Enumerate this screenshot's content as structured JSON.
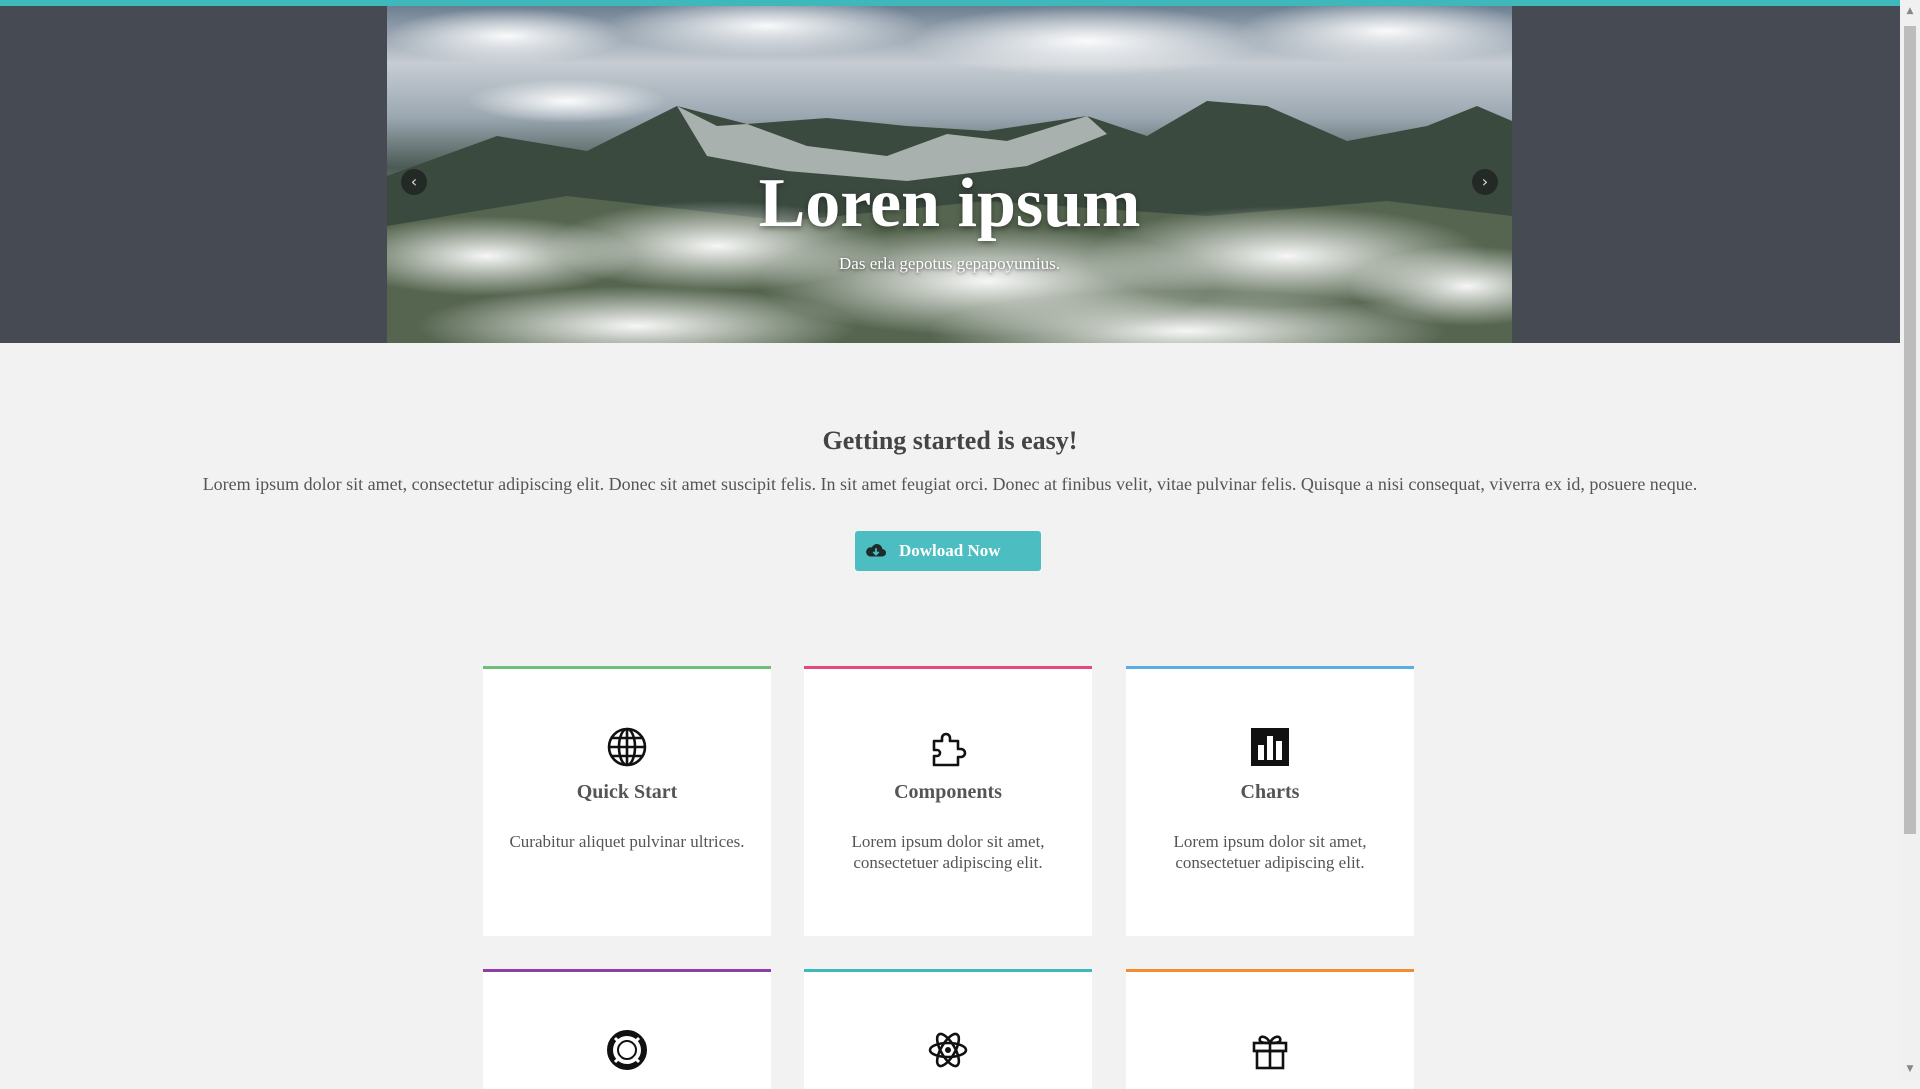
{
  "hero": {
    "title": "Loren ipsum",
    "subtitle": "Das erla gepotus gepapoyumius.",
    "prev_icon": "chevron-left-icon",
    "next_icon": "chevron-right-icon"
  },
  "intro": {
    "title": "Getting started is easy!",
    "text": "Lorem ipsum dolor sit amet, consectetur adipiscing elit. Donec sit amet suscipit felis. In sit amet feugiat orci. Donec at finibus velit, vitae pulvinar felis. Quisque a nisi consequat, viverra ex id, posuere neque.",
    "button_label": "Dowload Now",
    "button_icon": "cloud-download-icon",
    "accent_color": "#4cbec1"
  },
  "cards": [
    {
      "title": "Quick Start",
      "text": "Curabitur aliquet pulvinar ultrices.",
      "icon": "globe-icon",
      "color": "#6cc07a"
    },
    {
      "title": "Components",
      "text": "Lorem ipsum dolor sit amet, consectetuer adipiscing elit.",
      "icon": "puzzle-icon",
      "color": "#e2497c"
    },
    {
      "title": "Charts",
      "text": "Lorem ipsum dolor sit amet, consectetuer adipiscing elit.",
      "icon": "bar-chart-icon",
      "color": "#5aaee0"
    },
    {
      "title": "",
      "text": "",
      "icon": "lifebuoy-icon",
      "color": "#8e3fa4"
    },
    {
      "title": "",
      "text": "",
      "icon": "atom-icon",
      "color": "#3fb8bb"
    },
    {
      "title": "",
      "text": "",
      "icon": "gift-icon",
      "color": "#f28c2e"
    }
  ]
}
